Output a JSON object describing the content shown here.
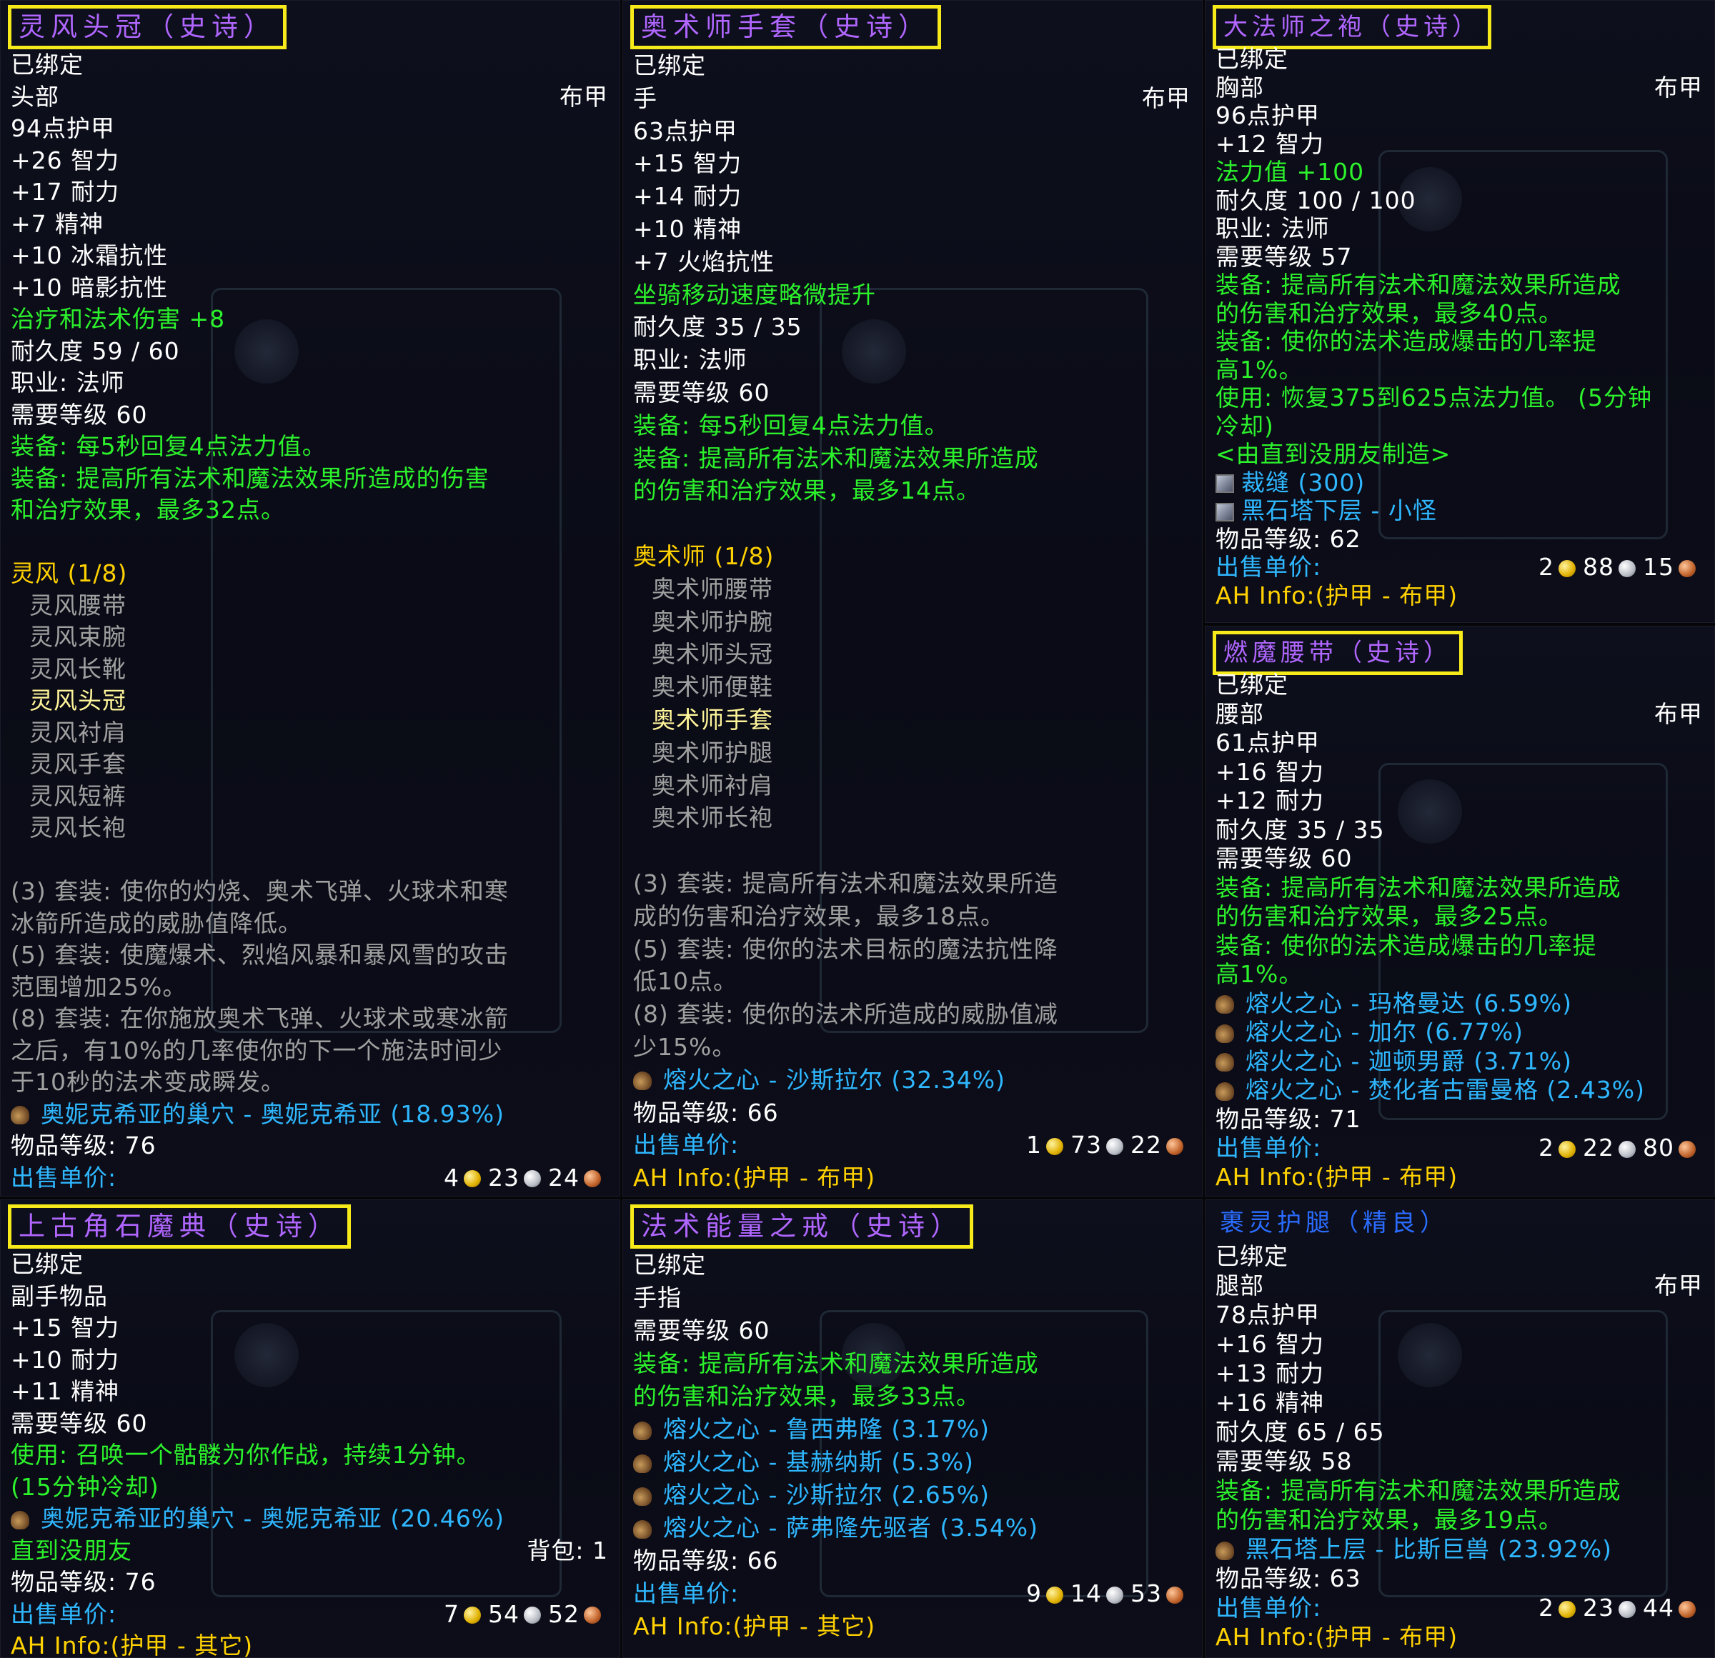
{
  "tooltips": [
    {
      "title": "灵风头冠（史诗）",
      "lines": [
        {
          "t": "已绑定"
        },
        {
          "t": "头部",
          "r": "布甲"
        },
        {
          "t": "94点护甲"
        },
        {
          "t": "+26 智力"
        },
        {
          "t": "+17 耐力"
        },
        {
          "t": "+7 精神"
        },
        {
          "t": "+10 冰霜抗性"
        },
        {
          "t": "+10 暗影抗性"
        },
        {
          "t": "治疗和法术伤害 +8",
          "c": "green"
        },
        {
          "t": "耐久度 59 / 60"
        },
        {
          "t": "职业: 法师"
        },
        {
          "t": "需要等级 60"
        },
        {
          "t": "装备: 每5秒回复4点法力值。",
          "c": "green"
        },
        {
          "t": "装备: 提高所有法术和魔法效果所造成的伤害",
          "c": "green"
        },
        {
          "t": "和治疗效果，最多32点。",
          "c": "green"
        },
        {
          "t": ""
        },
        {
          "t": "灵风 (1/8)",
          "c": "gold"
        },
        {
          "t": "灵风腰带",
          "c": "grey",
          "i": 1
        },
        {
          "t": "灵风束腕",
          "c": "grey",
          "i": 1
        },
        {
          "t": "灵风长靴",
          "c": "grey",
          "i": 1
        },
        {
          "t": "灵风头冠",
          "c": "hl",
          "i": 1
        },
        {
          "t": "灵风衬肩",
          "c": "grey",
          "i": 1
        },
        {
          "t": "灵风手套",
          "c": "grey",
          "i": 1
        },
        {
          "t": "灵风短裤",
          "c": "grey",
          "i": 1
        },
        {
          "t": "灵风长袍",
          "c": "grey",
          "i": 1
        },
        {
          "t": ""
        },
        {
          "t": "(3) 套装: 使你的灼烧、奥术飞弹、火球术和寒",
          "c": "grey"
        },
        {
          "t": "冰箭所造成的威胁值降低。",
          "c": "grey"
        },
        {
          "t": "(5) 套装: 使魔爆术、烈焰风暴和暴风雪的攻击",
          "c": "grey"
        },
        {
          "t": "范围增加25%。",
          "c": "grey"
        },
        {
          "t": "(8) 套装: 在你施放奥术飞弹、火球术或寒冰箭",
          "c": "grey"
        },
        {
          "t": "之后，有10%的几率使你的下一个施法时间少",
          "c": "grey"
        },
        {
          "t": "于10秒的法术变成瞬发。",
          "c": "grey"
        },
        {
          "t": "奥妮克希亚的巢穴 - 奥妮克希亚 (18.93%)",
          "c": "blue",
          "drop": 1
        },
        {
          "t": "物品等级: 76"
        },
        {
          "t": "出售单价:",
          "c": "blue",
          "coins": [
            "4",
            "23",
            "24"
          ]
        },
        {
          "t": "AH Info:(护甲 - 布甲)",
          "c": "gold"
        }
      ]
    },
    {
      "title": "奥术师手套（史诗）",
      "lines": [
        {
          "t": "已绑定"
        },
        {
          "t": "手",
          "r": "布甲"
        },
        {
          "t": "63点护甲"
        },
        {
          "t": "+15 智力"
        },
        {
          "t": "+14 耐力"
        },
        {
          "t": "+10 精神"
        },
        {
          "t": "+7 火焰抗性"
        },
        {
          "t": "坐骑移动速度略微提升",
          "c": "green"
        },
        {
          "t": "耐久度 35 / 35"
        },
        {
          "t": "职业: 法师"
        },
        {
          "t": "需要等级 60"
        },
        {
          "t": "装备: 每5秒回复4点法力值。",
          "c": "green"
        },
        {
          "t": "装备: 提高所有法术和魔法效果所造成",
          "c": "green"
        },
        {
          "t": "的伤害和治疗效果，最多14点。",
          "c": "green"
        },
        {
          "t": ""
        },
        {
          "t": "奥术师 (1/8)",
          "c": "gold"
        },
        {
          "t": "奥术师腰带",
          "c": "grey",
          "i": 1
        },
        {
          "t": "奥术师护腕",
          "c": "grey",
          "i": 1
        },
        {
          "t": "奥术师头冠",
          "c": "grey",
          "i": 1
        },
        {
          "t": "奥术师便鞋",
          "c": "grey",
          "i": 1
        },
        {
          "t": "奥术师手套",
          "c": "hl",
          "i": 1
        },
        {
          "t": "奥术师护腿",
          "c": "grey",
          "i": 1
        },
        {
          "t": "奥术师衬肩",
          "c": "grey",
          "i": 1
        },
        {
          "t": "奥术师长袍",
          "c": "grey",
          "i": 1
        },
        {
          "t": ""
        },
        {
          "t": "(3) 套装: 提高所有法术和魔法效果所造",
          "c": "grey"
        },
        {
          "t": "成的伤害和治疗效果，最多18点。",
          "c": "grey"
        },
        {
          "t": "(5) 套装: 使你的法术目标的魔法抗性降",
          "c": "grey"
        },
        {
          "t": "低10点。",
          "c": "grey"
        },
        {
          "t": "(8) 套装: 使你的法术所造成的威胁值减",
          "c": "grey"
        },
        {
          "t": "少15%。",
          "c": "grey"
        },
        {
          "t": "熔火之心 - 沙斯拉尔 (32.34%)",
          "c": "blue",
          "drop": 1
        },
        {
          "t": "物品等级: 66"
        },
        {
          "t": "出售单价:",
          "c": "blue",
          "coins": [
            "1",
            "73",
            "22"
          ]
        },
        {
          "t": "AH Info:(护甲 - 布甲)",
          "c": "gold"
        }
      ]
    },
    {
      "title": "大法师之袍（史诗）",
      "lines": [
        {
          "t": "已绑定"
        },
        {
          "t": "胸部",
          "r": "布甲"
        },
        {
          "t": "96点护甲"
        },
        {
          "t": "+12 智力"
        },
        {
          "t": "法力值 +100",
          "c": "green"
        },
        {
          "t": "耐久度 100 / 100"
        },
        {
          "t": "职业: 法师"
        },
        {
          "t": "需要等级 57"
        },
        {
          "t": "装备: 提高所有法术和魔法效果所造成",
          "c": "green"
        },
        {
          "t": "的伤害和治疗效果，最多40点。",
          "c": "green"
        },
        {
          "t": "装备: 使你的法术造成爆击的几率提",
          "c": "green"
        },
        {
          "t": "高1%。",
          "c": "green"
        },
        {
          "t": "使用: 恢复375到625点法力值。 (5分钟",
          "c": "green"
        },
        {
          "t": "冷却)",
          "c": "green"
        },
        {
          "t": "<由直到没朋友制造>",
          "c": "green"
        },
        {
          "t": "裁缝 (300)",
          "c": "blue",
          "mat": 1
        },
        {
          "t": "黑石塔下层 - 小怪",
          "c": "blue",
          "mat": 1
        },
        {
          "t": "物品等级: 62"
        },
        {
          "t": "出售单价:",
          "c": "blue",
          "coins": [
            "2",
            "88",
            "15"
          ]
        },
        {
          "t": "AH Info:(护甲 - 布甲)",
          "c": "gold"
        }
      ]
    },
    {
      "title": "燃魔腰带（史诗）",
      "lines": [
        {
          "t": "已绑定"
        },
        {
          "t": "腰部",
          "r": "布甲"
        },
        {
          "t": "61点护甲"
        },
        {
          "t": "+16 智力"
        },
        {
          "t": "+12 耐力"
        },
        {
          "t": "耐久度 35 / 35"
        },
        {
          "t": "需要等级 60"
        },
        {
          "t": "装备: 提高所有法术和魔法效果所造成",
          "c": "green"
        },
        {
          "t": "的伤害和治疗效果，最多25点。",
          "c": "green"
        },
        {
          "t": "装备: 使你的法术造成爆击的几率提",
          "c": "green"
        },
        {
          "t": "高1%。",
          "c": "green"
        },
        {
          "t": "熔火之心 - 玛格曼达 (6.59%)",
          "c": "blue",
          "drop": 1
        },
        {
          "t": "熔火之心 - 加尔 (6.77%)",
          "c": "blue",
          "drop": 1
        },
        {
          "t": "熔火之心 - 迦顿男爵 (3.71%)",
          "c": "blue",
          "drop": 1
        },
        {
          "t": "熔火之心 - 焚化者古雷曼格 (2.43%)",
          "c": "blue",
          "drop": 1
        },
        {
          "t": "物品等级: 71"
        },
        {
          "t": "出售单价:",
          "c": "blue",
          "coins": [
            "2",
            "22",
            "80"
          ]
        },
        {
          "t": "AH Info:(护甲 - 布甲)",
          "c": "gold"
        }
      ]
    },
    {
      "title": "上古角石魔典（史诗）",
      "lines": [
        {
          "t": "已绑定"
        },
        {
          "t": "副手物品"
        },
        {
          "t": "+15 智力"
        },
        {
          "t": "+10 耐力"
        },
        {
          "t": "+11 精神"
        },
        {
          "t": "需要等级 60"
        },
        {
          "t": "使用: 召唤一个骷髅为你作战，持续1分钟。",
          "c": "green"
        },
        {
          "t": "(15分钟冷却)",
          "c": "green"
        },
        {
          "t": "奥妮克希亚的巢穴 - 奥妮克希亚 (20.46%)",
          "c": "blue",
          "drop": 1
        },
        {
          "t": "直到没朋友",
          "c": "green",
          "r": "背包: 1"
        },
        {
          "t": "物品等级: 76"
        },
        {
          "t": "出售单价:",
          "c": "blue",
          "coins": [
            "7",
            "54",
            "52"
          ]
        },
        {
          "t": "AH Info:(护甲 - 其它)",
          "c": "gold"
        }
      ]
    },
    {
      "title": "法术能量之戒（史诗）",
      "lines": [
        {
          "t": "已绑定"
        },
        {
          "t": "手指"
        },
        {
          "t": "需要等级 60"
        },
        {
          "t": "装备: 提高所有法术和魔法效果所造成",
          "c": "green"
        },
        {
          "t": "的伤害和治疗效果，最多33点。",
          "c": "green"
        },
        {
          "t": "熔火之心 - 鲁西弗隆 (3.17%)",
          "c": "blue",
          "drop": 1
        },
        {
          "t": "熔火之心 - 基赫纳斯 (5.3%)",
          "c": "blue",
          "drop": 1
        },
        {
          "t": "熔火之心 - 沙斯拉尔 (2.65%)",
          "c": "blue",
          "drop": 1
        },
        {
          "t": "熔火之心 - 萨弗隆先驱者 (3.54%)",
          "c": "blue",
          "drop": 1
        },
        {
          "t": "物品等级: 66"
        },
        {
          "t": "出售单价:",
          "c": "blue",
          "coins": [
            "9",
            "14",
            "53"
          ]
        },
        {
          "t": "AH Info:(护甲 - 其它)",
          "c": "gold"
        }
      ]
    },
    {
      "title": "裹灵护腿（精良）",
      "lines": [
        {
          "t": "已绑定"
        },
        {
          "t": "腿部",
          "r": "布甲"
        },
        {
          "t": "78点护甲"
        },
        {
          "t": "+16 智力"
        },
        {
          "t": "+13 耐力"
        },
        {
          "t": "+16 精神"
        },
        {
          "t": "耐久度 65 / 65"
        },
        {
          "t": "需要等级 58"
        },
        {
          "t": "装备: 提高所有法术和魔法效果所造成",
          "c": "green"
        },
        {
          "t": "的伤害和治疗效果，最多19点。",
          "c": "green"
        },
        {
          "t": "黑石塔上层 - 比斯巨兽 (23.92%)",
          "c": "blue",
          "drop": 1
        },
        {
          "t": "物品等级: 63"
        },
        {
          "t": "出售单价:",
          "c": "blue",
          "coins": [
            "2",
            "23",
            "44"
          ]
        },
        {
          "t": "AH Info:(护甲 - 布甲)",
          "c": "gold"
        }
      ]
    }
  ],
  "colors": {
    "epic": "#b066ff",
    "rare": "#2a6cff",
    "title_frame": "#f6ea1a",
    "green": "#2cf22c",
    "gold": "#ffd100",
    "blue": "#2fb7ff"
  }
}
